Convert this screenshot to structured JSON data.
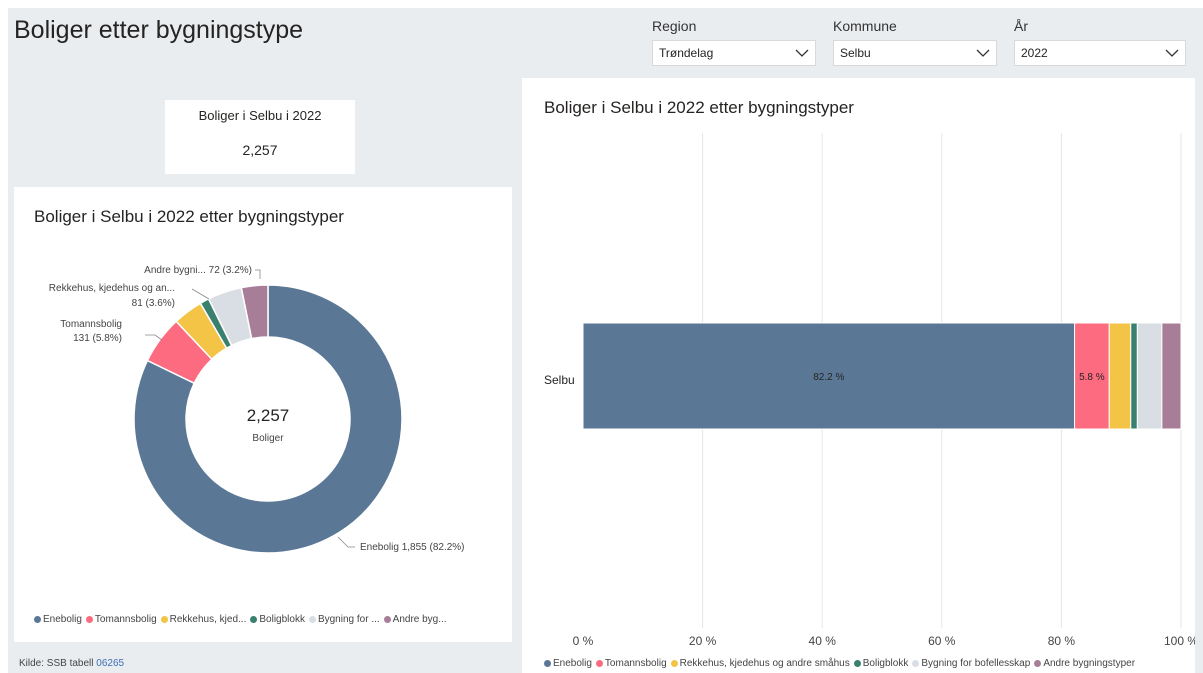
{
  "page": {
    "title": "Boliger etter bygningstype"
  },
  "slicers": [
    {
      "label": "Region",
      "value": "Trøndelag"
    },
    {
      "label": "Kommune",
      "value": "Selbu"
    },
    {
      "label": "År",
      "value": "2022"
    }
  ],
  "card": {
    "title": "Boliger i Selbu i 2022",
    "value": "2,257"
  },
  "donut": {
    "title": "Boliger i Selbu i 2022 etter bygningstyper",
    "center_value": "2,257",
    "center_label": "Boliger",
    "labels": [
      {
        "lines": [
          "Andre bygni... 72 (3.2%)"
        ]
      },
      {
        "lines": [
          "Rekkehus, kjedehus og an...",
          "81 (3.6%)"
        ]
      },
      {
        "lines": [
          "Tomannsbolig",
          "131 (5.8%)"
        ]
      },
      {
        "lines": [
          "Enebolig 1,855 (82.2%)"
        ]
      }
    ],
    "legend": [
      "Enebolig",
      "Tomannsbolig",
      "Rekkehus, kjed...",
      "Boligblokk",
      "Bygning for ...",
      "Andre byg..."
    ]
  },
  "bar": {
    "title": "Boliger i Selbu i 2022 etter bygningstyper",
    "category": "Selbu",
    "x_ticks": [
      "0 %",
      "20 %",
      "40 %",
      "60 %",
      "80 %",
      "100 %"
    ],
    "data_labels": [
      "82.2 %",
      "5.8 %"
    ],
    "legend": [
      "Enebolig",
      "Tomannsbolig",
      "Rekkehus, kjedehus og andre småhus",
      "Boligblokk",
      "Bygning for bofellesskap",
      "Andre bygningstyper"
    ]
  },
  "source": {
    "prefix": "Kilde: SSB tabell",
    "link": "06265"
  },
  "colors": [
    "#5a7896",
    "#fd6b81",
    "#f3c445",
    "#3a806f",
    "#d9dee4",
    "#a87d98"
  ],
  "chart_data": [
    {
      "type": "pie",
      "title": "Boliger i Selbu i 2022 etter bygningstyper",
      "categories": [
        "Enebolig",
        "Tomannsbolig",
        "Rekkehus, kjedehus og andre småhus",
        "Boligblokk",
        "Bygning for bofellesskap",
        "Andre bygningstyper"
      ],
      "values": [
        1855,
        131,
        81,
        25,
        93,
        72
      ],
      "total": 2257
    },
    {
      "type": "bar",
      "title": "Boliger i Selbu i 2022 etter bygningstyper",
      "categories": [
        "Selbu"
      ],
      "series": [
        {
          "name": "Enebolig",
          "values": [
            82.2
          ]
        },
        {
          "name": "Tomannsbolig",
          "values": [
            5.8
          ]
        },
        {
          "name": "Rekkehus, kjedehus og andre småhus",
          "values": [
            3.6
          ]
        },
        {
          "name": "Boligblokk",
          "values": [
            1.1
          ]
        },
        {
          "name": "Bygning for bofellesskap",
          "values": [
            4.1
          ]
        },
        {
          "name": "Andre bygningstyper",
          "values": [
            3.2
          ]
        }
      ],
      "xlim": [
        0,
        100
      ],
      "stacked": true,
      "orientation": "horizontal"
    }
  ]
}
